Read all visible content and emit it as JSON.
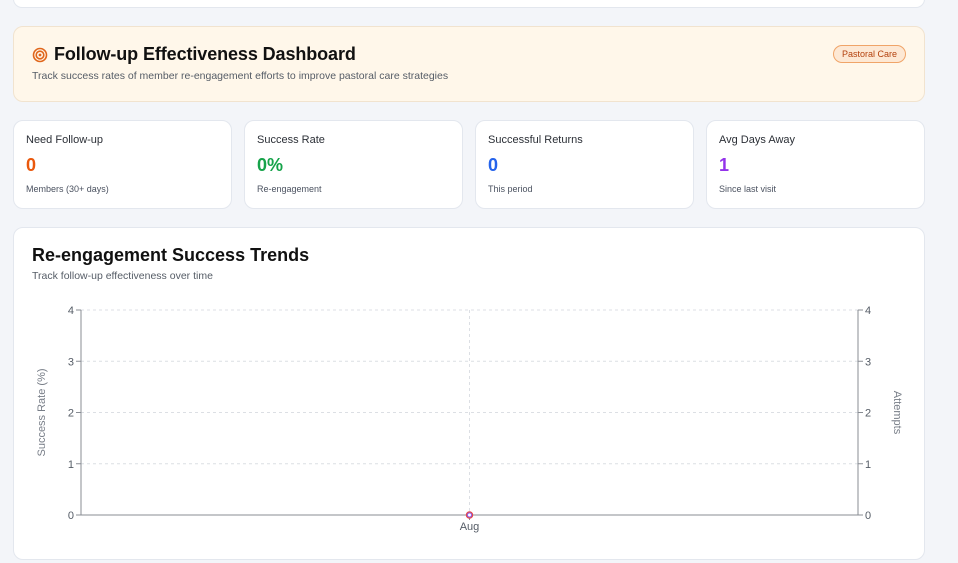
{
  "header": {
    "icon": "target-icon",
    "title": "Follow-up Effectiveness Dashboard",
    "subtitle": "Track success rates of member re-engagement efforts to improve pastoral care strategies",
    "badge": "Pastoral Care",
    "background": "#fff7ea",
    "accent": "#e0661b"
  },
  "stats": [
    {
      "label": "Need Follow-up",
      "value": "0",
      "sub": "Members (30+ days)",
      "color": "#ea580c"
    },
    {
      "label": "Success Rate",
      "value": "0%",
      "sub": "Re-engagement",
      "color": "#16a34a"
    },
    {
      "label": "Successful Returns",
      "value": "0",
      "sub": "This period",
      "color": "#2563eb"
    },
    {
      "label": "Avg Days Away",
      "value": "1",
      "sub": "Since last visit",
      "color": "#9333ea"
    }
  ],
  "trend": {
    "title": "Re-engagement Success Trends",
    "subtitle": "Track follow-up effectiveness over time"
  },
  "chart_data": {
    "type": "line",
    "categories": [
      "Aug"
    ],
    "series": [
      {
        "values": [
          0
        ],
        "axis": "left",
        "color": "#e04a4a"
      },
      {
        "values": [
          0
        ],
        "axis": "right",
        "color": "#8b5cf6"
      }
    ],
    "ylabel": "Success Rate (%)",
    "ylabel_right": "Attempts",
    "ylim": [
      0,
      4
    ],
    "ylim_right": [
      0,
      4
    ],
    "yticks": [
      0,
      1,
      2,
      3,
      4
    ],
    "yticks_right": [
      0,
      1,
      2,
      3,
      4
    ],
    "grid": true
  }
}
